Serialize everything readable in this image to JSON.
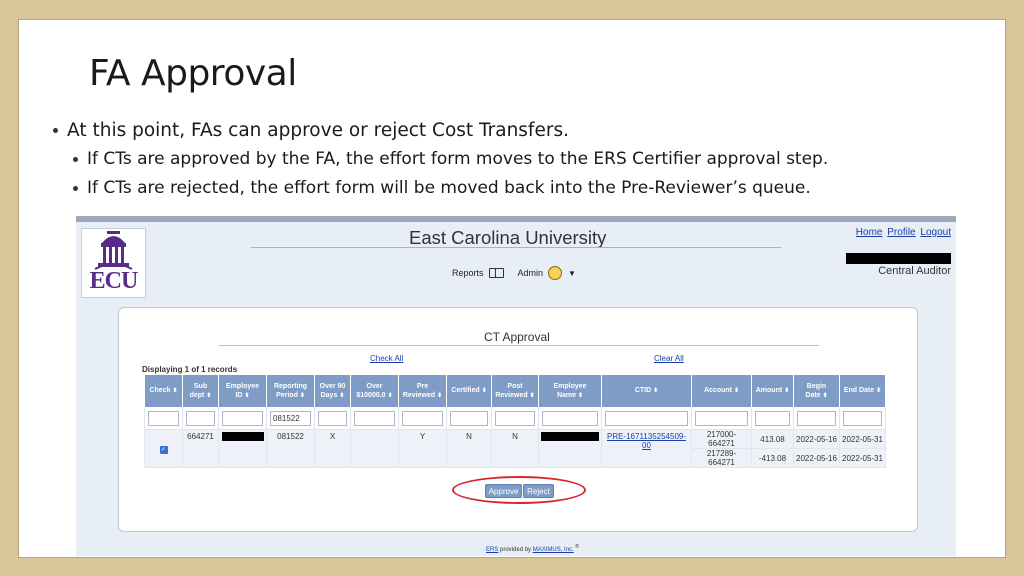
{
  "slide": {
    "title": "FA Approval",
    "bullet_main": "At this point, FAs can approve or reject Cost Transfers.",
    "bullet_sub1": "If CTs are approved by the FA, the effort form moves to the ERS Certifier approval step.",
    "bullet_sub2": "If CTs are rejected, the effort form will be moved back into the Pre-Reviewer’s queue."
  },
  "app": {
    "logo_text": "ECU",
    "university": "East Carolina University",
    "links": {
      "home": "Home",
      "profile": "Profile",
      "logout": "Logout"
    },
    "role": "Central Auditor",
    "menu": {
      "reports": "Reports",
      "admin": "Admin"
    }
  },
  "ct_approval": {
    "title": "CT Approval",
    "check_all": "Check All",
    "clear_all": "Clear All",
    "displaying": "Displaying 1 of 1 records",
    "columns": [
      "Check",
      "Sub dept",
      "Employee ID",
      "Reporting Period",
      "Over 90 Days",
      "Over $10000.0",
      "Pre Reviewed",
      "Certified",
      "Post Reviewed",
      "Employee Name",
      "CTID",
      "Account",
      "Amount",
      "Begin Date",
      "End Date"
    ],
    "filter_reporting_period": "081522",
    "row": {
      "sub_dept": "664271",
      "reporting_period": "081522",
      "over90": "X",
      "pre_reviewed": "Y",
      "certified": "N",
      "post_reviewed": "N",
      "ctid": "PRE-1671135254509-00",
      "lines": [
        {
          "account": "217000-664271",
          "amount": "413.08",
          "begin": "2022-05-16",
          "end": "2022-05-31"
        },
        {
          "account": "217289-664271",
          "amount": "-413.08",
          "begin": "2022-05-16",
          "end": "2022-05-31"
        }
      ]
    },
    "approve_label": "Approve",
    "reject_label": "Reject"
  },
  "footer": {
    "ers": "ERS",
    "provided": " provided by ",
    "maximus": "MAXIMUS, Inc.",
    "mark": " ®"
  },
  "colors": {
    "header_blue": "#7f9cc6",
    "ecu_purple": "#592a8a",
    "highlight_red": "#d7272e",
    "frame_tan": "#d8c59a"
  }
}
